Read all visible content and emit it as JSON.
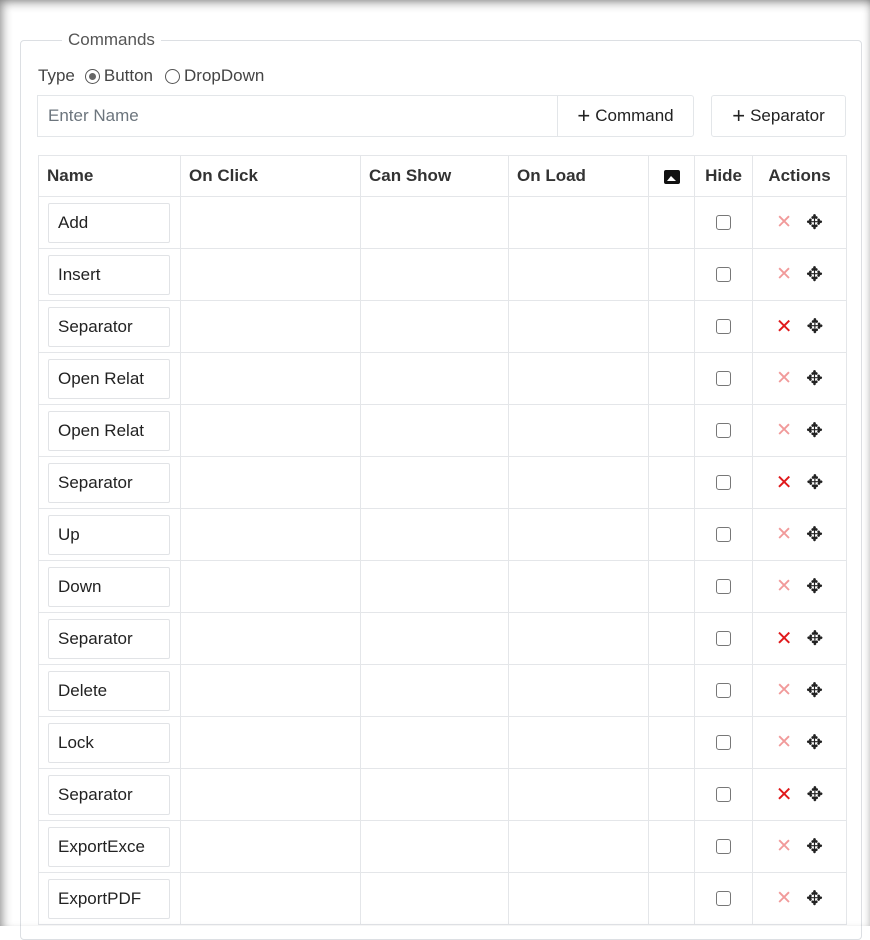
{
  "section": {
    "legend": "Commands"
  },
  "type_selector": {
    "label": "Type",
    "options": [
      {
        "label": "Button",
        "selected": true
      },
      {
        "label": "DropDown",
        "selected": false
      }
    ]
  },
  "name_input": {
    "placeholder": "Enter Name",
    "value": ""
  },
  "buttons": {
    "command_label": "Command",
    "separator_label": "Separator"
  },
  "table": {
    "headers": {
      "name": "Name",
      "on_click": "On Click",
      "can_show": "Can Show",
      "on_load": "On Load",
      "image_icon": "image-icon",
      "hide": "Hide",
      "actions": "Actions"
    },
    "rows": [
      {
        "name": "Add",
        "separator": false
      },
      {
        "name": "Insert",
        "separator": false
      },
      {
        "name": "Separator",
        "separator": true
      },
      {
        "name": "Open Relat",
        "separator": false
      },
      {
        "name": "Open Relat",
        "separator": false
      },
      {
        "name": "Separator",
        "separator": true
      },
      {
        "name": "Up",
        "separator": false
      },
      {
        "name": "Down",
        "separator": false
      },
      {
        "name": "Separator",
        "separator": true
      },
      {
        "name": "Delete",
        "separator": false
      },
      {
        "name": "Lock",
        "separator": false
      },
      {
        "name": "Separator",
        "separator": true
      },
      {
        "name": "ExportExce",
        "separator": false
      },
      {
        "name": "ExportPDF",
        "separator": false
      }
    ]
  },
  "colors": {
    "delete_light": "#f19a9a",
    "delete_strong": "#e0191b",
    "border": "#e4e6e9"
  }
}
